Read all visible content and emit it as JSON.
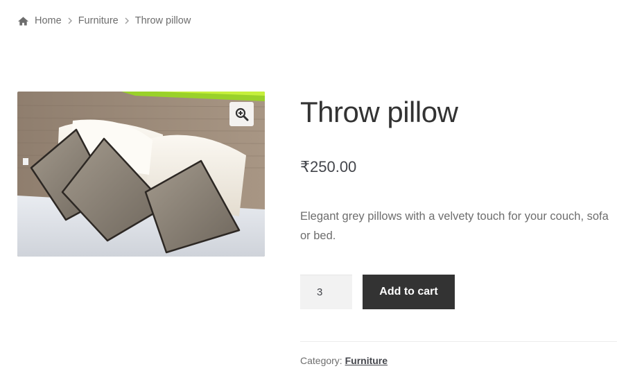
{
  "breadcrumb": {
    "home": "Home",
    "category": "Furniture",
    "current": "Throw pillow"
  },
  "icons": {
    "home": "home-icon",
    "separator": "chevron-right-icon",
    "zoom": "zoom-in-icon"
  },
  "product": {
    "title": "Throw pillow",
    "price": "₹250.00",
    "description": "Elegant grey pillows with a velvety touch for your couch, sofa or bed.",
    "quantity": "3",
    "add_to_cart_label": "Add to cart",
    "category_label": "Category:",
    "category_value": "Furniture"
  },
  "colors": {
    "button_bg": "#333333",
    "button_text": "#ffffff",
    "body_text": "#6d6d6d",
    "heading": "#333333"
  }
}
